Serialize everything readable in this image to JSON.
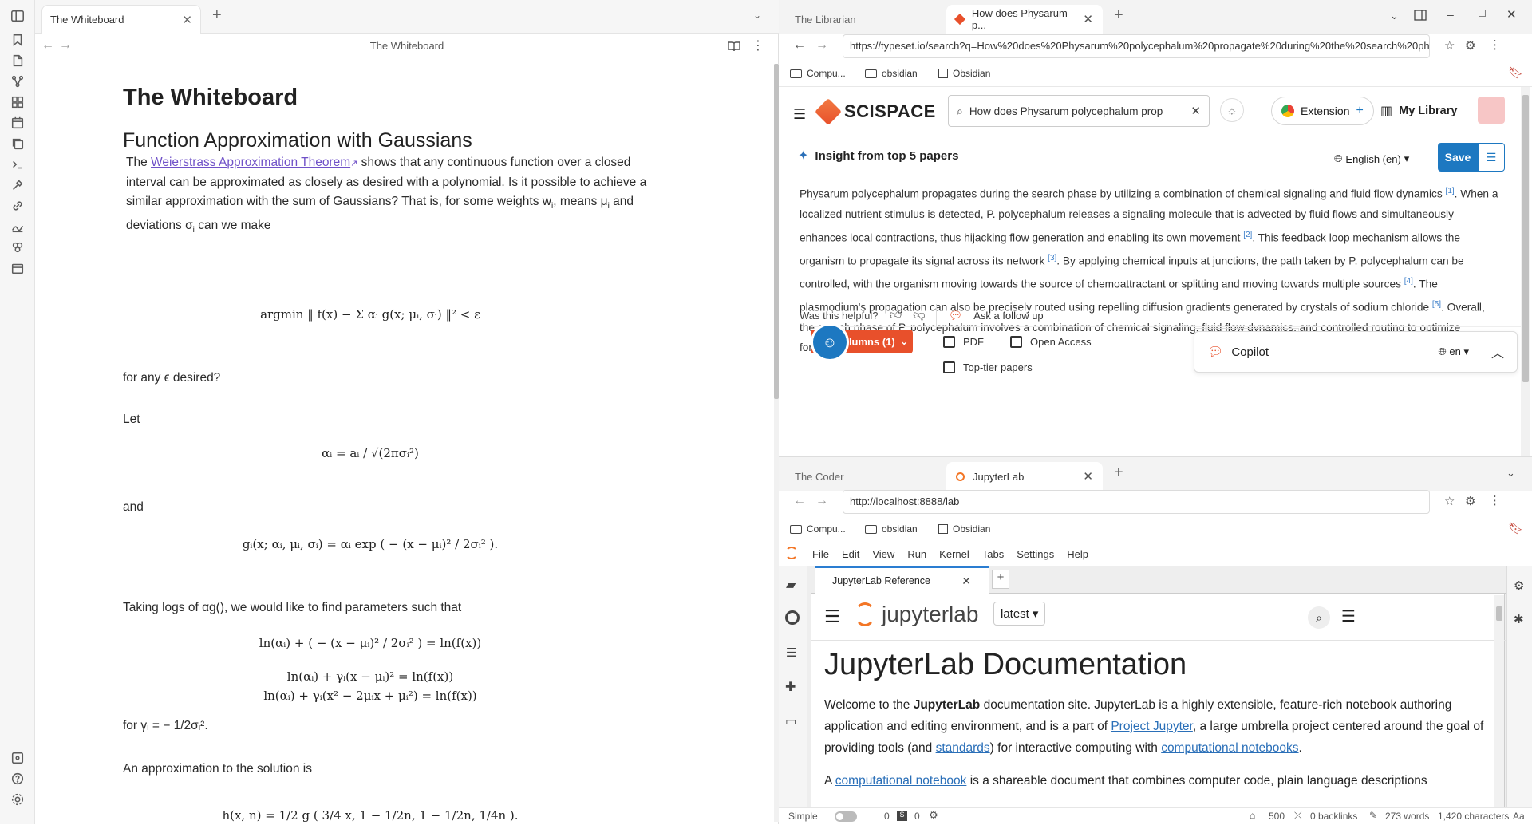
{
  "obsidian": {
    "tab_title": "The Whiteboard",
    "view_title": "The Whiteboard",
    "note": {
      "h1": "The Whiteboard",
      "h2": "Function Approximation with Gaussians",
      "p1_before_link": "The ",
      "p1_link": "Weierstrass Approximation Theorem",
      "p1_after_link": " shows that any continuous function over a closed interval can be approximated as closely as desired with a polynomial. Is it possible to achieve a similar approximation with the sum of Gaussians? That is, for some weights w",
      "p1_tail": ", means μ",
      "p1_tail2": " and deviations σ",
      "p1_tail3": " can we make",
      "eq1": "argmin ‖ f(x) − Σ αᵢ g(x; μᵢ, σᵢ) ‖² < ε",
      "p_any_eps": "for any ϵ desired?",
      "p_let": "Let",
      "eq_alpha": "αᵢ = aᵢ / √(2πσᵢ²)",
      "p_and": "and",
      "eq_g": "gᵢ(x; αᵢ, μᵢ, σᵢ) = αᵢ exp ( − (x − μᵢ)² / 2σᵢ² ).",
      "p_logs": "Taking logs of αg(), we would like to find parameters such that",
      "eq_l1": "ln(αᵢ) + ( − (x − μᵢ)² / 2σᵢ² ) = ln(f(x))",
      "eq_l2": "ln(αᵢ) + γᵢ(x − μᵢ)² = ln(f(x))",
      "eq_l3": "ln(αᵢ) + γᵢ(x² − 2μᵢx + μᵢ²) = ln(f(x))",
      "p_gamma": "for γᵢ = − 1/2σᵢ².",
      "p_approx": "An approximation to the solution is",
      "eq_h": "h(x, n) = 1/2 g ( 3/4 x, 1 − 1/2n, 1 − 1/2n, 1/4n )."
    }
  },
  "browser_top": {
    "tab1": "The Librarian",
    "tab2": "How does Physarum p...",
    "url": "https://typeset.io/search?q=How%20does%20Physarum%20polycephalum%20propagate%20during%20the%20search%20phase?",
    "bookmarks": [
      "Compu...",
      "obsidian",
      "Obsidian"
    ],
    "scispace": {
      "brand": "SCISPACE",
      "search_value": "How does Physarum polycephalum prop",
      "extension_label": "Extension",
      "library_label": "My Library",
      "insight_title": "Insight from top 5 papers",
      "language": "English (en)",
      "save_label": "Save",
      "answer_segments": [
        "Physarum polycephalum propagates during the search phase by utilizing a combination of chemical signaling and fluid flow dynamics ",
        ". When a localized nutrient stimulus is detected, P. polycephalum releases a signaling molecule that is advected by fluid flows and simultaneously enhances local contractions, thus hijacking flow generation and enabling its own movement ",
        ". This feedback loop mechanism allows the organism to propagate its signal across its network ",
        ". By applying chemical inputs at junctions, the path taken by P. polycephalum can be controlled, with the organism moving towards the source of chemoattractant or splitting and moving towards multiple sources ",
        ". The plasmodium's propagation can also be precisely routed using repelling diffusion gradients generated by crystals of sodium chloride ",
        ". Overall, the search phase of P. polycephalum involves a combination of chemical signaling, fluid flow dynamics, and controlled routing to optimize foraging behavior ."
      ],
      "citations": [
        "[1]",
        "[2]",
        "[3]",
        "[4]",
        "[5]"
      ],
      "helpful_label": "Was this helpful?",
      "follow_up": "Ask a follow up",
      "columns_label": "olumns (1)",
      "filter_pdf": "PDF",
      "filter_open": "Open Access",
      "filter_top": "Top-tier papers",
      "copilot_label": "Copilot",
      "copilot_lang": "en"
    }
  },
  "browser_bottom": {
    "tab1": "The Coder",
    "tab2": "JupyterLab",
    "url": "http://localhost:8888/lab",
    "bookmarks": [
      "Compu...",
      "obsidian",
      "Obsidian"
    ],
    "menu": [
      "File",
      "Edit",
      "View",
      "Run",
      "Kernel",
      "Tabs",
      "Settings",
      "Help"
    ],
    "doc_tab": "JupyterLab Reference",
    "version_select": "latest",
    "logo_text": "jupyterlab",
    "doc_title": "JupyterLab Documentation",
    "p_welcome_1": "Welcome to the ",
    "p_welcome_bold": "JupyterLab",
    "p_welcome_2": " documentation site. JupyterLab is a highly extensible, feature-rich notebook authoring application and editing environment, and is a part of ",
    "p_welcome_link1": "Project Jupyter",
    "p_welcome_3": ", a large umbrella project centered around the goal of providing tools (and ",
    "p_welcome_link2": "standards",
    "p_welcome_4": ") for interactive computing with ",
    "p_welcome_link3": "computational notebooks",
    "p_welcome_5": ".",
    "p2_start": "A ",
    "p2_link": "computational notebook",
    "p2_rest": " is a shareable document that combines computer code, plain language descriptions"
  },
  "status": {
    "simple_label": "Simple",
    "count_a": "0",
    "count_b": "0",
    "num_500": "500",
    "backlinks": "0 backlinks",
    "words": "273 words",
    "chars": "1,420 characters",
    "aa": "Aa"
  }
}
